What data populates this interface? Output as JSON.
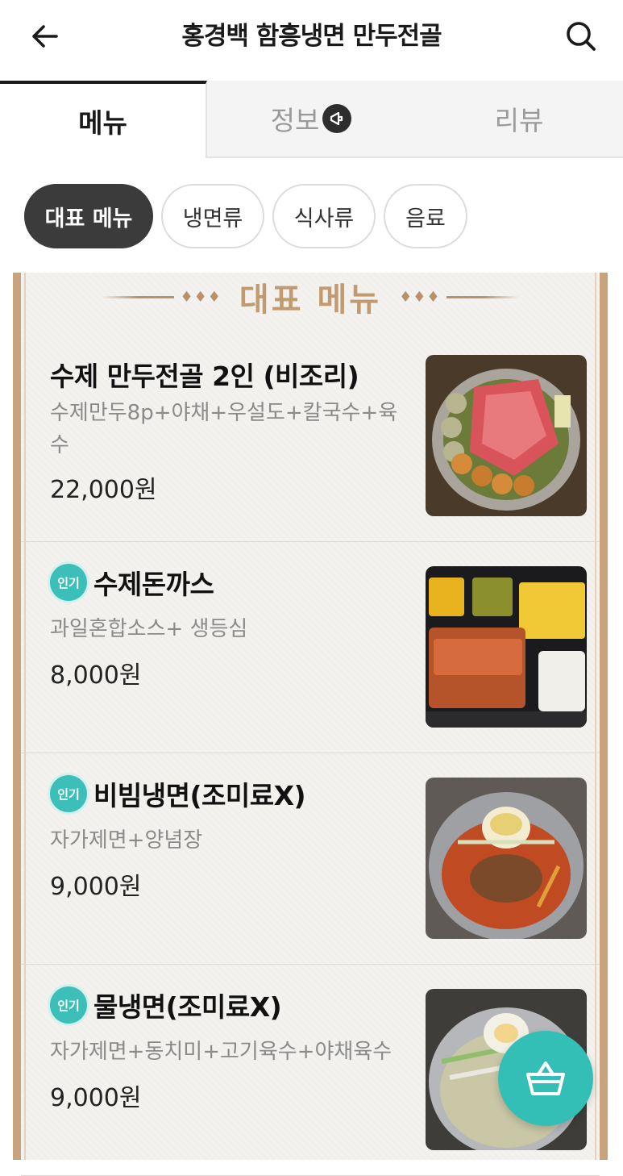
{
  "header": {
    "title": "홍경백 함흥냉면 만두전골",
    "back_icon": "arrow-left-icon",
    "search_icon": "search-icon"
  },
  "tabs": [
    {
      "label": "메뉴",
      "active": true
    },
    {
      "label": "정보",
      "active": false,
      "icon": "megaphone-icon"
    },
    {
      "label": "리뷰",
      "active": false
    }
  ],
  "categories": [
    {
      "label": "대표 메뉴",
      "active": true
    },
    {
      "label": "냉면류",
      "active": false
    },
    {
      "label": "식사류",
      "active": false
    },
    {
      "label": "음료",
      "active": false
    }
  ],
  "section": {
    "title": "대표 메뉴",
    "decoration": "♦♦♦"
  },
  "items": [
    {
      "name": "수제 만두전골 2인 (비조리)",
      "desc": "수제만두8p+야채+우설도+칼국수+육수",
      "price": "22,000원",
      "popular": false
    },
    {
      "name": "수제돈까스",
      "desc": "과일혼합소스+ 생등심",
      "price": "8,000원",
      "popular": true,
      "badge": "인기"
    },
    {
      "name": "비빔냉면(조미료X)",
      "desc": "자가제면+양념장",
      "price": "9,000원",
      "popular": true,
      "badge": "인기"
    },
    {
      "name": "물냉면(조미료X)",
      "desc": "자가제면+동치미+고기육수+야채육수",
      "price": "9,000원",
      "popular": true,
      "badge": "인기"
    }
  ],
  "cart": {
    "icon": "basket-icon"
  },
  "colors": {
    "accent_teal": "#33bfb6",
    "frame_brown": "#c9a37b",
    "chip_active": "#3b3b3b"
  }
}
